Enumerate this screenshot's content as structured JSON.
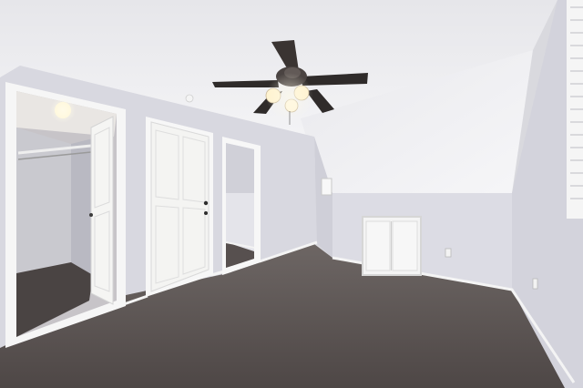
{
  "scene": {
    "description_free": true,
    "colors": {
      "ceiling": "#f1f1f3",
      "wall": "#dcdce3",
      "wall_shadow": "#c9c9d2",
      "trim": "#f7f7f7",
      "door": "#f4f4f2",
      "carpet": "#5f5856",
      "carpet_dark": "#4d4645",
      "fan_blade": "#2f2b2a",
      "light": "#fff5d8"
    }
  }
}
